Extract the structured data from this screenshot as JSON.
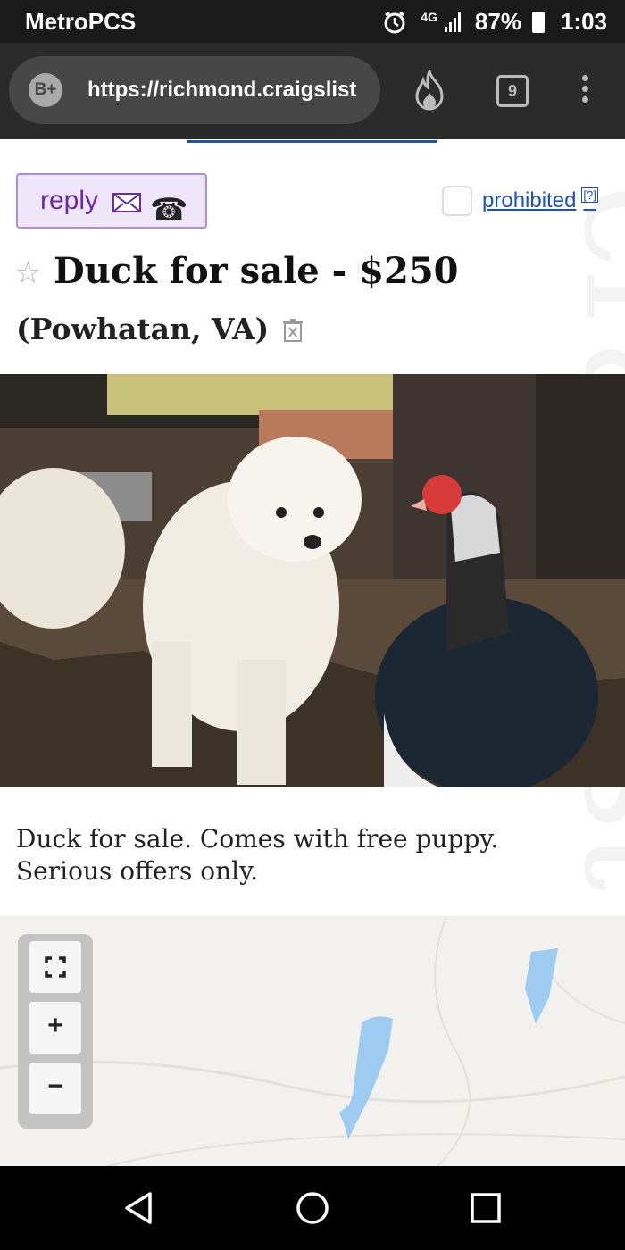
{
  "status_bar": {
    "carrier": "MetroPCS",
    "network": "4G",
    "battery": "87%",
    "time": "1:03"
  },
  "browser": {
    "url": "https://richmond.craigslist",
    "tab_count": "9",
    "badge": "B+"
  },
  "posting": {
    "reply_label": "reply",
    "prohibited_label": "prohibited",
    "help_mark": "[?]",
    "title": "Duck for sale - $250",
    "location": "(Powhatan, VA)",
    "description_line1": "Duck for sale. Comes with free puppy.",
    "description_line2": "Serious offers only."
  },
  "map": {
    "zoom_in": "+",
    "zoom_out": "−"
  },
  "colors": {
    "link": "#1a50c8",
    "reply_bg": "#f0e6fb",
    "reply_border": "#b28bd6",
    "water": "#9ecbf2"
  }
}
